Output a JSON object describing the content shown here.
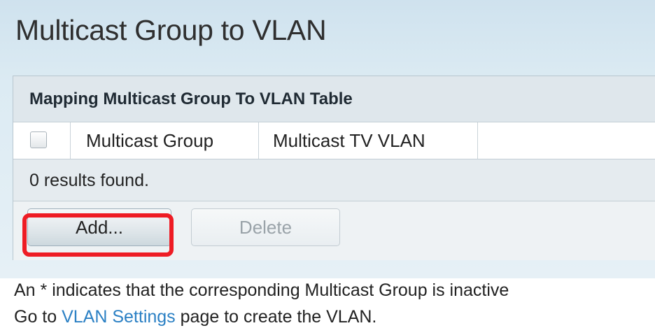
{
  "page": {
    "title": "Multicast Group to VLAN"
  },
  "table": {
    "caption": "Mapping Multicast Group To VLAN Table",
    "columns": [
      "Multicast Group",
      "Multicast TV VLAN"
    ],
    "rows": [],
    "results_text": "0 results found."
  },
  "buttons": {
    "add_label": "Add...",
    "delete_label": "Delete",
    "delete_disabled": true
  },
  "notes": {
    "line1": "An * indicates that the corresponding Multicast Group is inactive",
    "line2_prefix": "Go to ",
    "line2_link": "VLAN Settings",
    "line2_suffix": " page to create the VLAN."
  },
  "colors": {
    "highlight": "#ee1c24",
    "link": "#2b80c4",
    "header_band": "#cfe2ee"
  }
}
